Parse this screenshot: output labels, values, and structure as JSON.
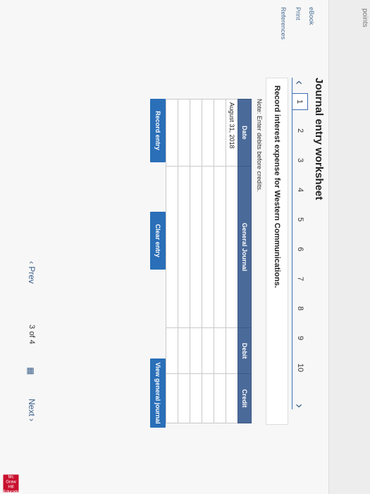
{
  "header": {
    "points_label": "points"
  },
  "nav": {
    "ebook": "eBook",
    "print": "Print",
    "references": "References"
  },
  "title": "Journal entry worksheet",
  "tabs": {
    "prev_icon": "‹",
    "next_icon": "›",
    "items": [
      "1",
      "2",
      "3",
      "4",
      "5",
      "6",
      "7",
      "8",
      "9",
      "10"
    ],
    "active": "1"
  },
  "prompt": "Record interest expense for Western Communications.",
  "note": "Note: Enter debits before credits.",
  "table": {
    "headers": {
      "date": "Date",
      "journal": "General Journal",
      "debit": "Debit",
      "credit": "Credit"
    },
    "first_date": "August 31, 2018"
  },
  "buttons": {
    "record": "Record entry",
    "clear": "Clear entry",
    "view": "View general journal"
  },
  "footer": {
    "prev": "‹ Prev",
    "page_current": "3",
    "page_of": "of",
    "page_total": "4",
    "next": "Next ›"
  },
  "brand": {
    "logo_text": "Mc Graw Hill Education",
    "color": "#c8102e"
  }
}
